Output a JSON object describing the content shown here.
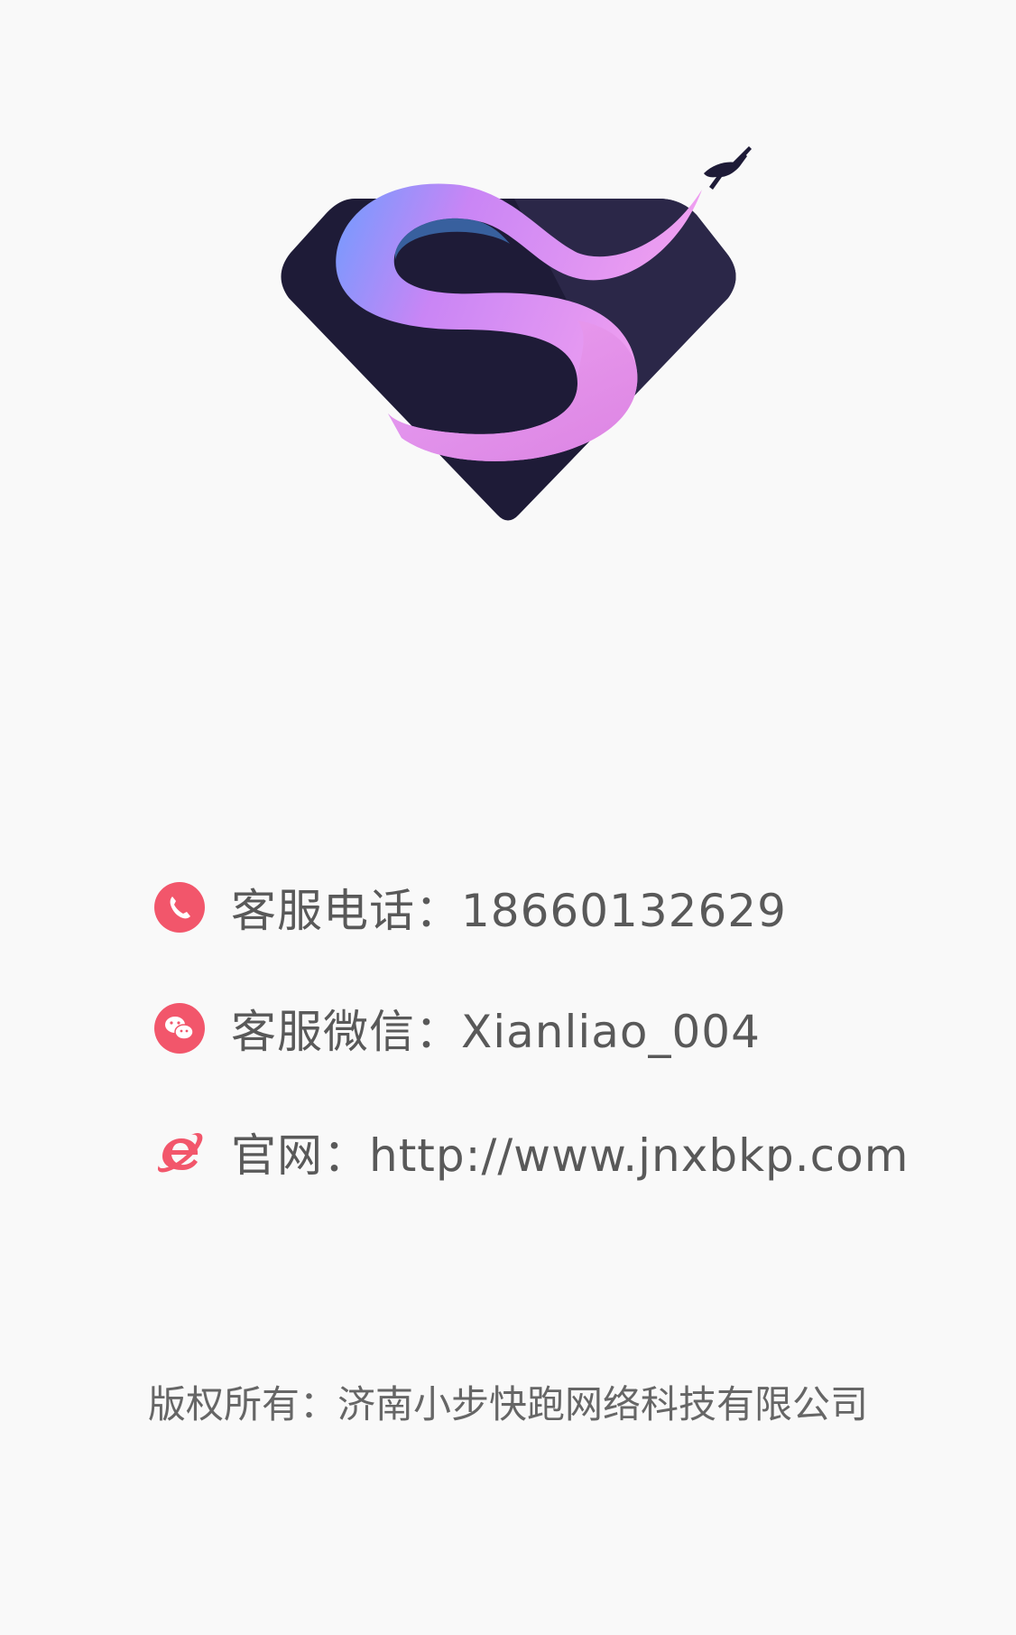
{
  "logo": {
    "icon": "superhero-s-shield-logo",
    "shield_color": "#1e1b37",
    "ribbon_gradient": [
      "#6f9cff",
      "#c985f5",
      "#f3a2f0"
    ]
  },
  "contacts": [
    {
      "icon": "phone-icon",
      "color": "#f2566b",
      "text": "客服电话：18660132629"
    },
    {
      "icon": "wechat-icon",
      "color": "#f2566b",
      "text": "客服微信：Xianliao_004"
    },
    {
      "icon": "browser-e-icon",
      "color": "#f2566b",
      "text": "官网：http://www.jnxbkp.com"
    }
  ],
  "footer": {
    "copyright": "版权所有：济南小步快跑网络科技有限公司"
  }
}
